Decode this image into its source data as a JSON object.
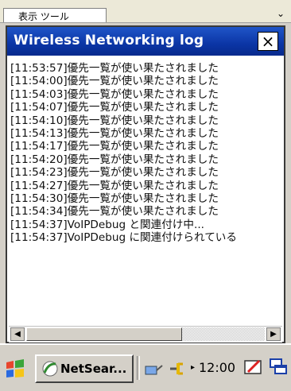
{
  "underlying": {
    "menu_text": "表示  ツール",
    "arrow": "⌄"
  },
  "window": {
    "title": "Wireless Networking log",
    "close_label": "×"
  },
  "log_lines": [
    "[11:53:57]優先一覧が使い果たされました",
    "[11:54:00]優先一覧が使い果たされました",
    "[11:54:03]優先一覧が使い果たされました",
    "[11:54:07]優先一覧が使い果たされました",
    "[11:54:10]優先一覧が使い果たされました",
    "[11:54:13]優先一覧が使い果たされました",
    "[11:54:17]優先一覧が使い果たされました",
    "[11:54:20]優先一覧が使い果たされました",
    "[11:54:23]優先一覧が使い果たされました",
    "[11:54:27]優先一覧が使い果たされました",
    "[11:54:30]優先一覧が使い果たされました",
    "[11:54:34]優先一覧が使い果たされました",
    "[11:54:37]VoIPDebug と関連付け中...",
    "[11:54:37]VoIPDebug に関連付けられている"
  ],
  "scrollbar": {
    "left_arrow": "◀",
    "right_arrow": "▶"
  },
  "taskbar": {
    "start_icon": "start-flag-icon",
    "task_label": "NetSear...",
    "clock": "12:00",
    "clock_arrow": "▸",
    "tray_icons": [
      "network-icon",
      "power-plug-icon",
      "pen-icon",
      "window-switch-icon"
    ]
  }
}
